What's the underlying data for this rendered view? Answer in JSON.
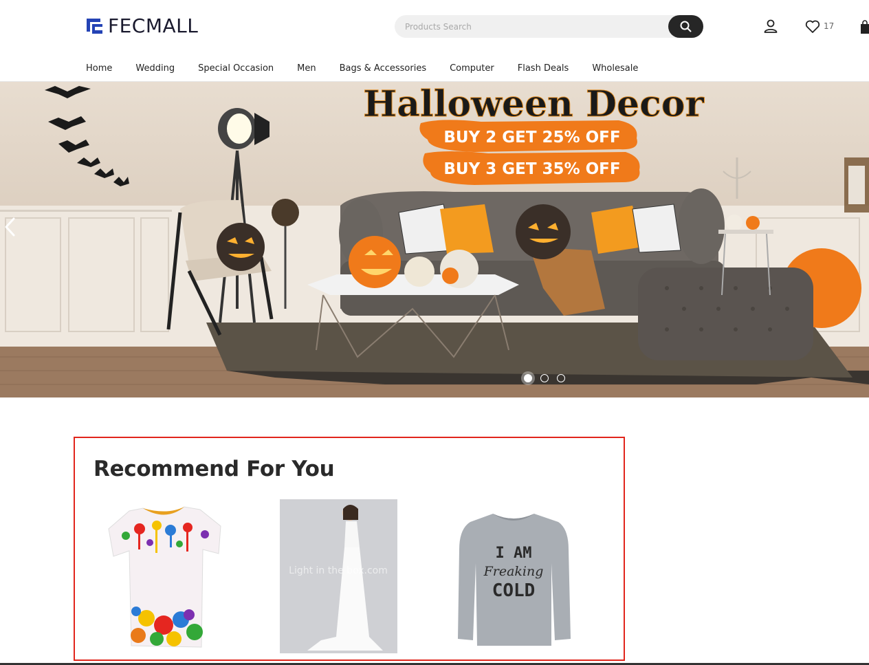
{
  "header": {
    "logo_text": "FECMALL",
    "search_placeholder": "Products Search",
    "wishlist_count": "17"
  },
  "nav": {
    "items": [
      "Home",
      "Wedding",
      "Special Occasion",
      "Men",
      "Bags & Accessories",
      "Computer",
      "Flash Deals",
      "Wholesale"
    ]
  },
  "banner": {
    "title": "Halloween Decor",
    "offer_1": "BUY 2 GET 25% OFF",
    "offer_2": "BUY 3 GET 35% OFF",
    "slides": 3,
    "active_slide": 1
  },
  "recommend": {
    "title": "Recommend For You",
    "products": [
      {
        "icon": "paint-splatter-tshirt"
      },
      {
        "icon": "white-wedding-dress",
        "watermark": "Light in the box.com"
      },
      {
        "icon": "grey-sweatshirt",
        "print_1": "I AM",
        "print_2": "Freaking",
        "print_3": "COLD"
      }
    ]
  },
  "colors": {
    "accent_orange": "#f07a1a",
    "highlight_border": "#e1251b",
    "search_button": "#262626"
  }
}
